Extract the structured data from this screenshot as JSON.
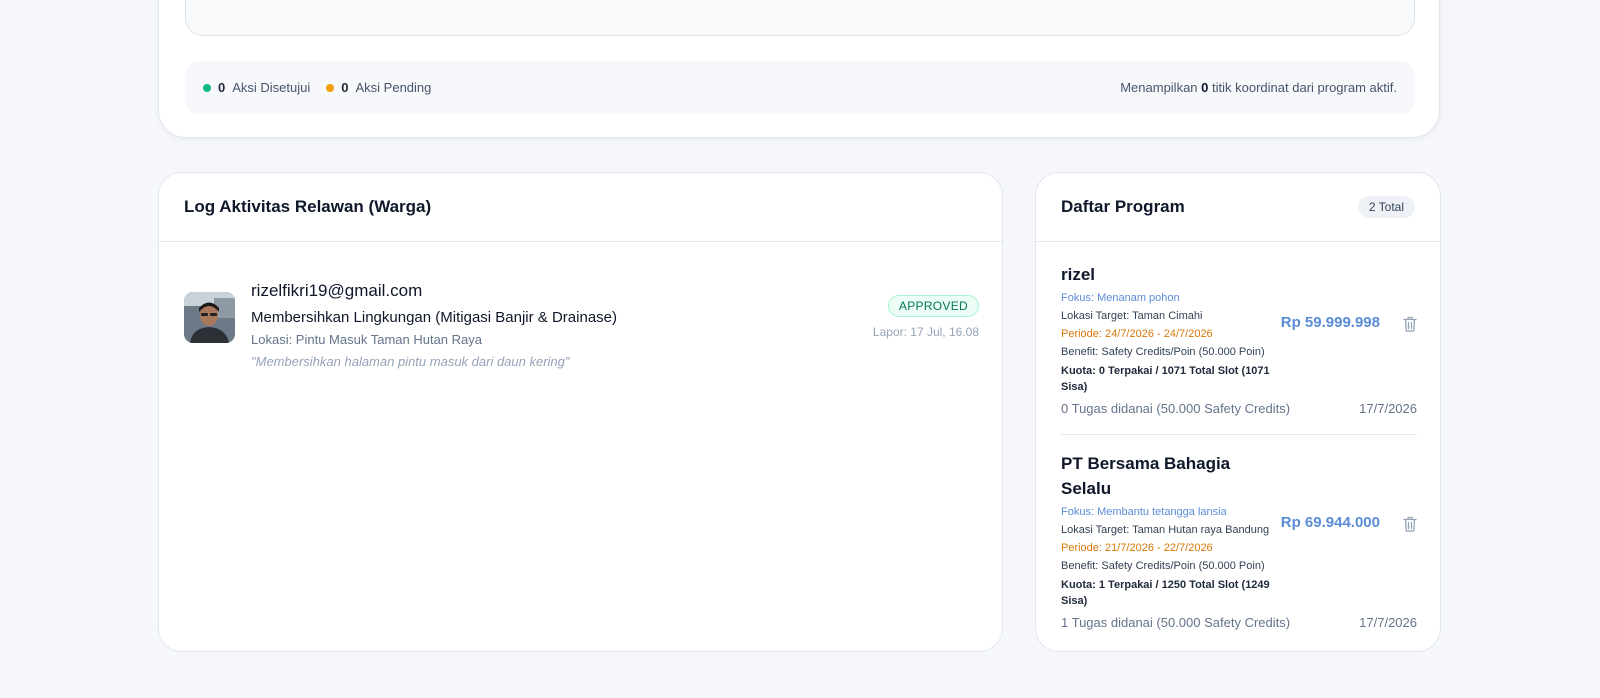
{
  "map_stats": {
    "approved_count": "0",
    "approved_label": "Aksi Disetujui",
    "pending_count": "0",
    "pending_label": "Aksi Pending",
    "summary_prefix": "Menampilkan",
    "summary_count": "0",
    "summary_suffix": "titik koordinat dari program aktif."
  },
  "log": {
    "title": "Log Aktivitas Relawan (Warga)",
    "entries": [
      {
        "email": "rizelfikri19@gmail.com",
        "action": "Membersihkan Lingkungan (Mitigasi Banjir & Drainase)",
        "location": "Lokasi: Pintu Masuk Taman Hutan Raya",
        "note": "\"Membersihkan halaman pintu masuk dari daun kering\"",
        "status": "APPROVED",
        "reported": "Lapor: 17 Jul, 16.08"
      }
    ]
  },
  "programs": {
    "title": "Daftar Program",
    "total": "2 Total",
    "items": [
      {
        "name": "rizel",
        "focus": "Fokus: Menanam pohon",
        "location": "Lokasi Target: Taman Cimahi",
        "period": "Periode: 24/7/2026 - 24/7/2026",
        "benefit": "Benefit: Safety Credits/Poin (50.000 Poin)",
        "quota": "Kuota: 0 Terpakai / 1071 Total Slot (1071 Sisa)",
        "amount": "Rp 59.999.998",
        "tasks": "0 Tugas didanai (50.000 Safety Credits)",
        "date": "17/7/2026"
      },
      {
        "name": "PT Bersama Bahagia Selalu",
        "focus": "Fokus: Membantu tetangga lansia",
        "location": "Lokasi Target: Taman Hutan raya Bandung",
        "period": "Periode: 21/7/2026 - 22/7/2026",
        "benefit": "Benefit: Safety Credits/Poin (50.000 Poin)",
        "quota": "Kuota: 1 Terpakai / 1250 Total Slot (1249 Sisa)",
        "amount": "Rp 69.944.000",
        "tasks": "1 Tugas didanai (50.000 Safety Credits)",
        "date": "17/7/2026"
      }
    ]
  },
  "icons": {
    "status_approved_dot": "green-dot-icon",
    "status_pending_dot": "orange-dot-icon",
    "delete": "trash-icon"
  },
  "colors": {
    "accent_blue": "#5b8dd6",
    "approved_green": "#10b981",
    "pending_orange": "#f59e0b",
    "period_orange": "#d97706"
  }
}
